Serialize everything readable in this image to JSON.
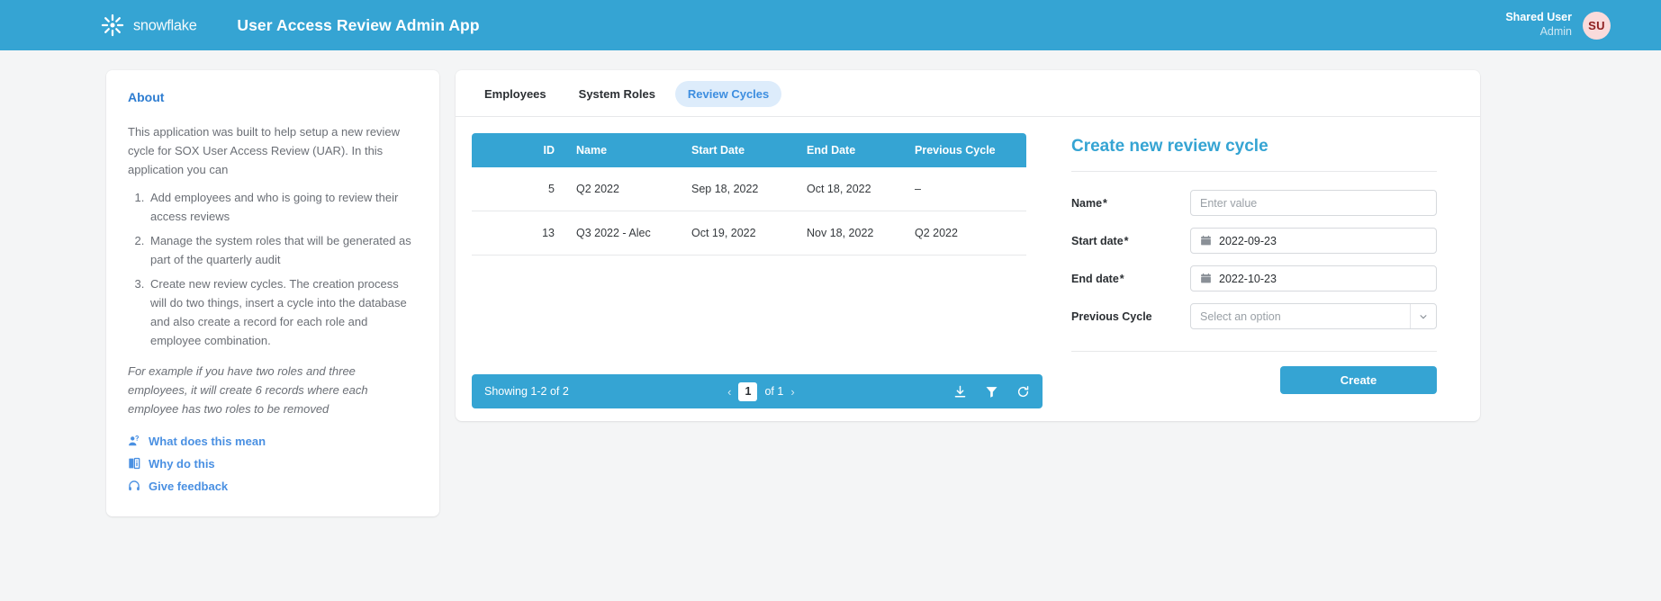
{
  "header": {
    "brand_name": "snowflake",
    "app_title": "User Access Review Admin App",
    "user_name": "Shared User",
    "user_role": "Admin",
    "avatar_initials": "SU",
    "background_color": "#35a4d3",
    "avatar_bg_color": "#fadbdb",
    "avatar_text_color": "#8e2020"
  },
  "about": {
    "title": "About",
    "intro": "This application was built to help setup a new review cycle for SOX User Access Review (UAR). In this application you can",
    "steps": [
      "Add employees and who is going to review their access reviews",
      "Manage the system roles that will be generated as part of the quarterly audit",
      "Create new review cycles. The creation process will do two things, insert a cycle into the database and also create a record for each role and employee combination."
    ],
    "note": "For example if you have two roles and three employees, it will create 6 records where each employee has two roles to be removed",
    "links": [
      {
        "label": "What does this mean",
        "icon": "people-question-icon"
      },
      {
        "label": "Why do this",
        "icon": "book-info-icon"
      },
      {
        "label": "Give feedback",
        "icon": "headset-icon"
      }
    ],
    "link_color": "#4a90e2",
    "title_color": "#2e7dd1"
  },
  "tabs": [
    {
      "label": "Employees",
      "active": false
    },
    {
      "label": "System Roles",
      "active": false
    },
    {
      "label": "Review Cycles",
      "active": true
    }
  ],
  "table": {
    "columns": [
      "ID",
      "Name",
      "Start Date",
      "End Date",
      "Previous Cycle"
    ],
    "header_bg": "#35a4d3",
    "rows": [
      {
        "id": "5",
        "name": "Q2 2022",
        "start_date": "Sep 18, 2022",
        "end_date": "Oct 18, 2022",
        "previous_cycle": "–"
      },
      {
        "id": "13",
        "name": "Q3 2022 - Alec",
        "start_date": "Oct 19, 2022",
        "end_date": "Nov 18, 2022",
        "previous_cycle": "Q2 2022"
      }
    ],
    "footer": {
      "showing": "Showing 1-2 of 2",
      "prev_arrow": "‹",
      "page_number": "1",
      "of_total": "of 1",
      "next_arrow": "›",
      "icons": [
        "download-icon",
        "filter-icon",
        "refresh-icon"
      ]
    }
  },
  "form": {
    "title": "Create new review cycle",
    "title_color": "#35a4d3",
    "fields": [
      {
        "label": "Name",
        "required": true,
        "type": "text",
        "value": "",
        "placeholder": "Enter value"
      },
      {
        "label": "Start date",
        "required": true,
        "type": "date",
        "value": "2022-09-23",
        "placeholder": ""
      },
      {
        "label": "End date",
        "required": true,
        "type": "date",
        "value": "2022-10-23",
        "placeholder": ""
      },
      {
        "label": "Previous Cycle",
        "required": false,
        "type": "select",
        "value": "",
        "placeholder": "Select an option"
      }
    ],
    "required_marker": "*",
    "submit_label": "Create",
    "submit_color": "#35a4d3"
  }
}
